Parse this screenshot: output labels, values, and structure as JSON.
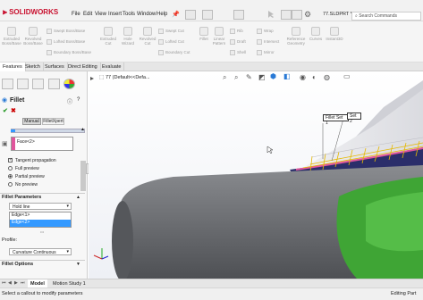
{
  "app": {
    "brand": "SOLIDWORKS"
  },
  "menu": [
    "File",
    "Edit",
    "View",
    "Insert",
    "Tools",
    "Window",
    "Help"
  ],
  "title": {
    "part": "77.SLDPRT *"
  },
  "search": {
    "placeholder": "Search Commands"
  },
  "cmd_buttons": {
    "big": [
      "Extruded Boss/Base",
      "Revolved Boss/Base",
      "Extruded Cut",
      "Hole Wizard",
      "Revolved Cut",
      "Fillet",
      "Linear Pattern",
      "Rib",
      "Draft",
      "Shell",
      "Reference Geometry",
      "Curves",
      "Instant3D"
    ],
    "small": [
      "Swept Boss/Base",
      "Lofted Boss/Base",
      "Boundary Boss/Base",
      "Swept Cut",
      "Lofted Cut",
      "Boundary Cut",
      "Wrap",
      "Intersect",
      "Mirror"
    ]
  },
  "tabs": [
    "Features",
    "Sketch",
    "Surfaces",
    "Direct Editing",
    "Evaluate"
  ],
  "tree": {
    "root": "77 (Default<<Defa..."
  },
  "panel": {
    "title": "Fillet",
    "mode_manual": "Manual",
    "mode_filletxpert": "FilletXpert",
    "face_item": "Face<2>",
    "tangent": "Tangent propagation",
    "full_preview": "Full preview",
    "partial_preview": "Partial preview",
    "no_preview": "No preview",
    "fillet_params": "Fillet Parameters",
    "method": "Hold line",
    "edge1": "Edge<1>",
    "edge2": "Edge<2>",
    "profile_label": "Profile:",
    "profile_value": "Curvature Continuous",
    "fillet_options": "Fillet Options"
  },
  "callouts": {
    "set1": "Fillet Set 1",
    "set2": "Set 2"
  },
  "bottom_tabs": [
    "Model",
    "Motion Study 1"
  ],
  "status": {
    "left": "Select a callout to modify parameters",
    "right": "Editing Part"
  },
  "colors": {
    "accent": "#c8102e",
    "selection": "#3399ff",
    "body_grey": "#6e7074",
    "green": "#3fa535",
    "navy": "#2b2e6a"
  }
}
